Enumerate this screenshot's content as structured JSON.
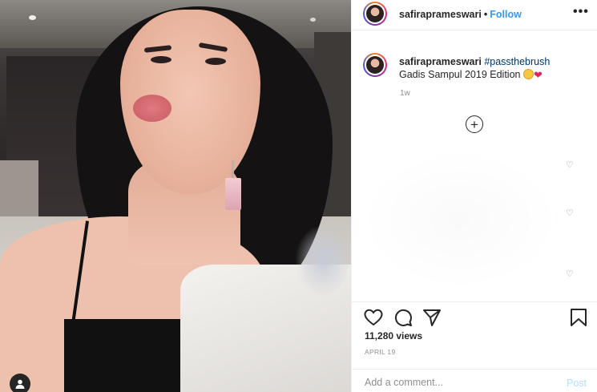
{
  "header": {
    "username": "safiraprameswari",
    "separator": "•",
    "follow_label": "Follow",
    "more_label": "•••"
  },
  "caption": {
    "username": "safiraprameswari",
    "hashtag": "#passthebrush",
    "text": "Gadis Sampul 2019 Edition",
    "emoji_names": [
      "grinning-face-emoji",
      "red-heart-emoji"
    ],
    "time": "1w"
  },
  "comments": {
    "load_more_icon": "plus-circle-icon",
    "like_icons": [
      "heart-outline-icon",
      "heart-outline-icon",
      "heart-outline-icon"
    ]
  },
  "actions": {
    "icons": [
      "heart-icon",
      "comment-icon",
      "share-icon",
      "bookmark-icon"
    ],
    "views": "11,280 views",
    "date": "APRIL 19"
  },
  "comment_box": {
    "placeholder": "Add a comment...",
    "post_label": "Post"
  },
  "media": {
    "user_tag_icon": "person-icon"
  },
  "colors": {
    "link_blue": "#3897f0",
    "hashtag_blue": "#003569",
    "text": "#262626",
    "muted": "#8e8e8e",
    "post_disabled": "#b2dffc"
  }
}
